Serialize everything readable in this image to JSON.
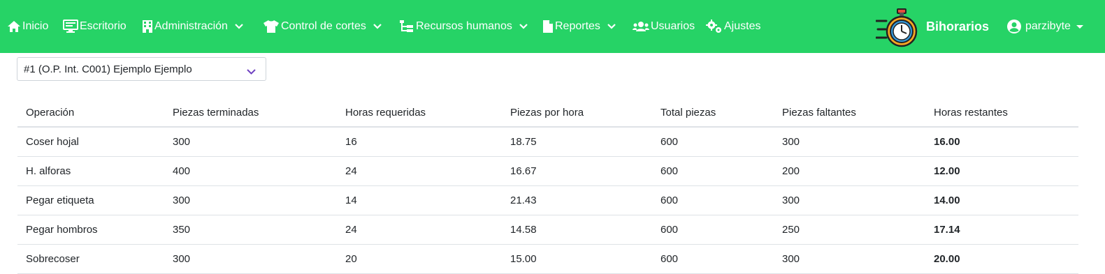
{
  "nav": {
    "items": [
      {
        "label": "Inicio",
        "icon": "home-icon",
        "dropdown": false
      },
      {
        "label": "Escritorio",
        "icon": "desktop-icon",
        "dropdown": false
      },
      {
        "label": "Administración",
        "icon": "building-icon",
        "dropdown": true
      },
      {
        "label": "Control de cortes",
        "icon": "shirt-icon",
        "dropdown": true
      },
      {
        "label": "Recursos humanos",
        "icon": "sitemap-icon",
        "dropdown": true
      },
      {
        "label": "Reportes",
        "icon": "file-icon",
        "dropdown": true
      },
      {
        "label": "Usuarios",
        "icon": "users-icon",
        "dropdown": false
      },
      {
        "label": "Ajustes",
        "icon": "cogs-icon",
        "dropdown": false
      }
    ],
    "brand": "Bihorarios",
    "user": "parzibyte",
    "bg_color": "#26d366"
  },
  "order_select": {
    "value": "#1 (O.P. Int. C001) Ejemplo Ejemplo"
  },
  "table": {
    "headers": [
      "Operación",
      "Piezas terminadas",
      "Horas requeridas",
      "Piezas por hora",
      "Total piezas",
      "Piezas faltantes",
      "Horas restantes"
    ],
    "rows": [
      [
        "Coser hojal",
        "300",
        "16",
        "18.75",
        "600",
        "300",
        "16.00"
      ],
      [
        "H. alforas",
        "400",
        "24",
        "16.67",
        "600",
        "200",
        "12.00"
      ],
      [
        "Pegar etiqueta",
        "300",
        "14",
        "21.43",
        "600",
        "300",
        "14.00"
      ],
      [
        "Pegar hombros",
        "350",
        "24",
        "14.58",
        "600",
        "250",
        "17.14"
      ],
      [
        "Sobrecoser",
        "300",
        "20",
        "15.00",
        "600",
        "300",
        "20.00"
      ]
    ]
  }
}
